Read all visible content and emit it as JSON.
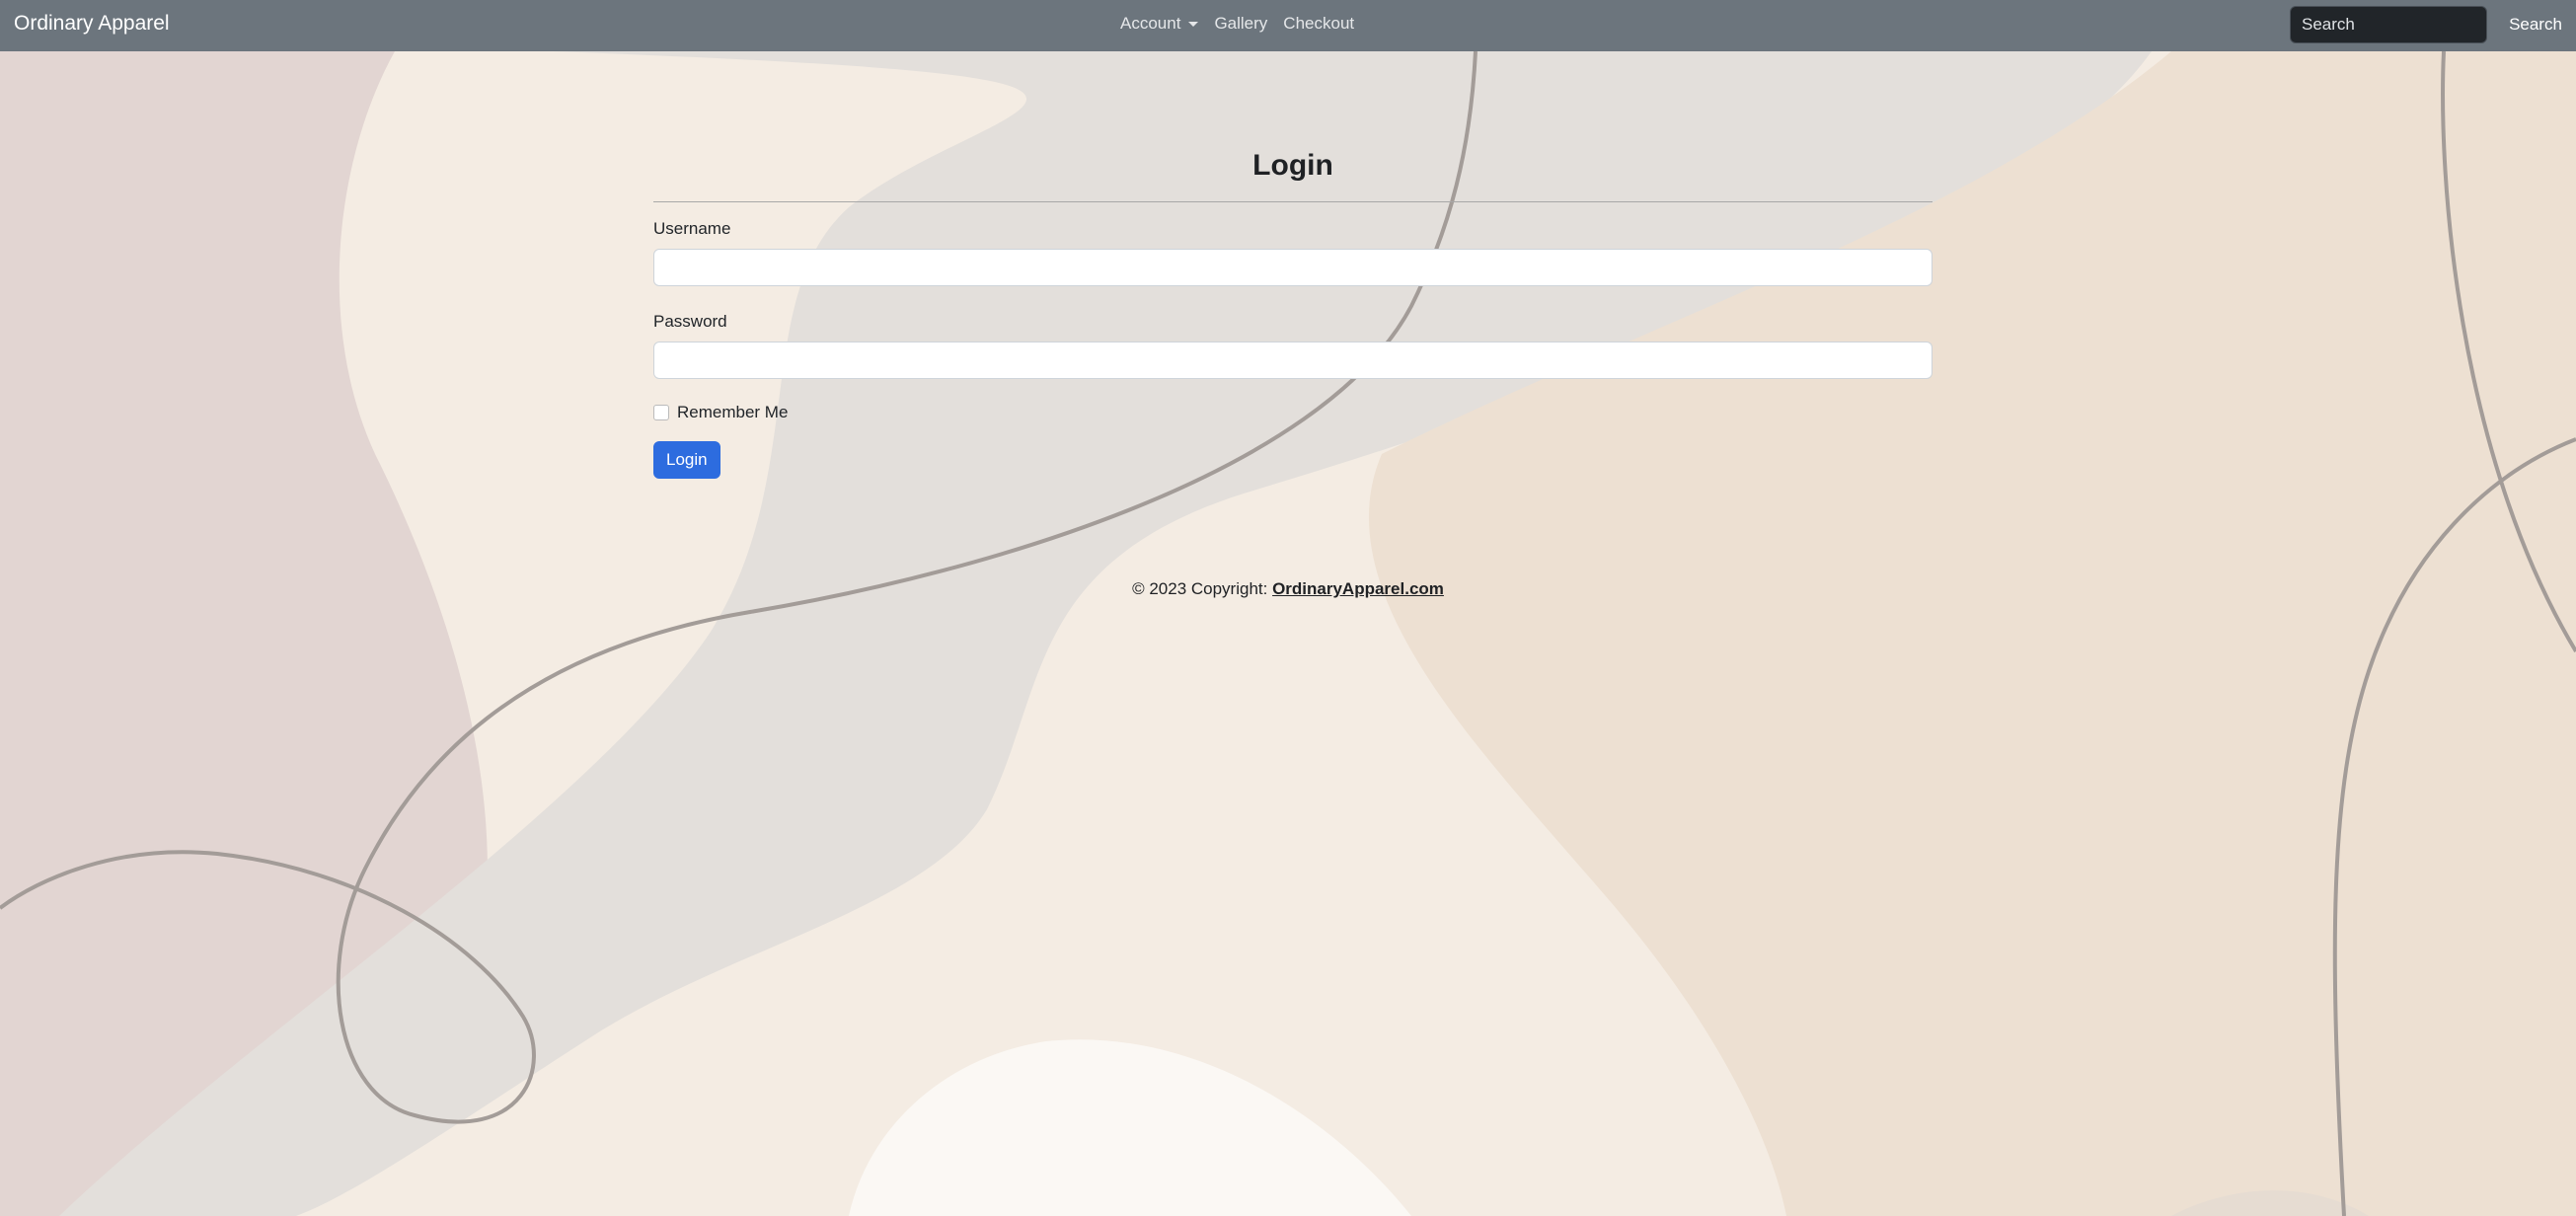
{
  "navbar": {
    "brand": "Ordinary Apparel",
    "links": [
      {
        "label": "Account",
        "has_dropdown": true
      },
      {
        "label": "Gallery"
      },
      {
        "label": "Checkout"
      }
    ],
    "search": {
      "placeholder": "Search",
      "button_label": "Search"
    }
  },
  "login": {
    "title": "Login",
    "username_label": "Username",
    "password_label": "Password",
    "remember_label": "Remember Me",
    "remember_checked": false,
    "submit_label": "Login"
  },
  "footer": {
    "text": "© 2023 Copyright: ",
    "link_text": "OrdinaryApparel.com"
  },
  "colors": {
    "navbar": "#6c757d",
    "primary_button": "#2d6cdf",
    "background": "#f4ece3"
  }
}
